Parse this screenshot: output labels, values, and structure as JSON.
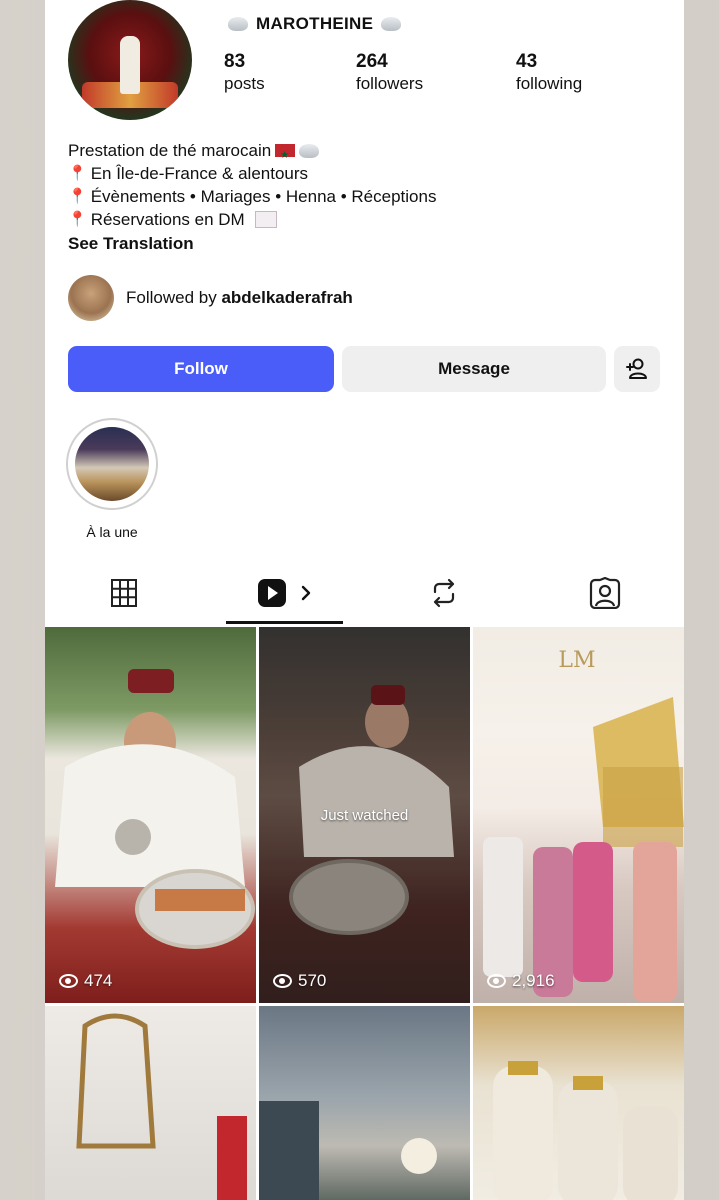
{
  "profile": {
    "username": "MAROTHEINE",
    "stats": [
      {
        "num": "83",
        "label": "posts"
      },
      {
        "num": "264",
        "label": "followers"
      },
      {
        "num": "43",
        "label": "following"
      }
    ]
  },
  "bio": {
    "line1": "Prestation de thé marocain",
    "line2": "En Île-de-France & alentours",
    "line3": "Évènements • Mariages • Henna • Réceptions",
    "line4": "Réservations en DM",
    "see_translation": "See Translation"
  },
  "followed_by": {
    "prefix": "Followed by",
    "user": "abdelkaderafrah"
  },
  "actions": {
    "follow": "Follow",
    "message": "Message"
  },
  "highlight": {
    "label": "À la une"
  },
  "tabs": [
    {
      "name": "grid",
      "icon": "grid-icon",
      "active": false
    },
    {
      "name": "reels",
      "icon": "reels-icon",
      "active": true
    },
    {
      "name": "reposts",
      "icon": "repost-icon",
      "active": false
    },
    {
      "name": "tagged",
      "icon": "tagged-icon",
      "active": false
    }
  ],
  "grid": {
    "items": [
      {
        "views": "474"
      },
      {
        "views": "570",
        "overlay": "Just watched"
      },
      {
        "views": "2,916"
      },
      {
        "views": ""
      },
      {
        "views": ""
      },
      {
        "views": ""
      }
    ]
  },
  "colors": {
    "follow_button": "#4a5df9",
    "secondary_button": "#efefef"
  }
}
